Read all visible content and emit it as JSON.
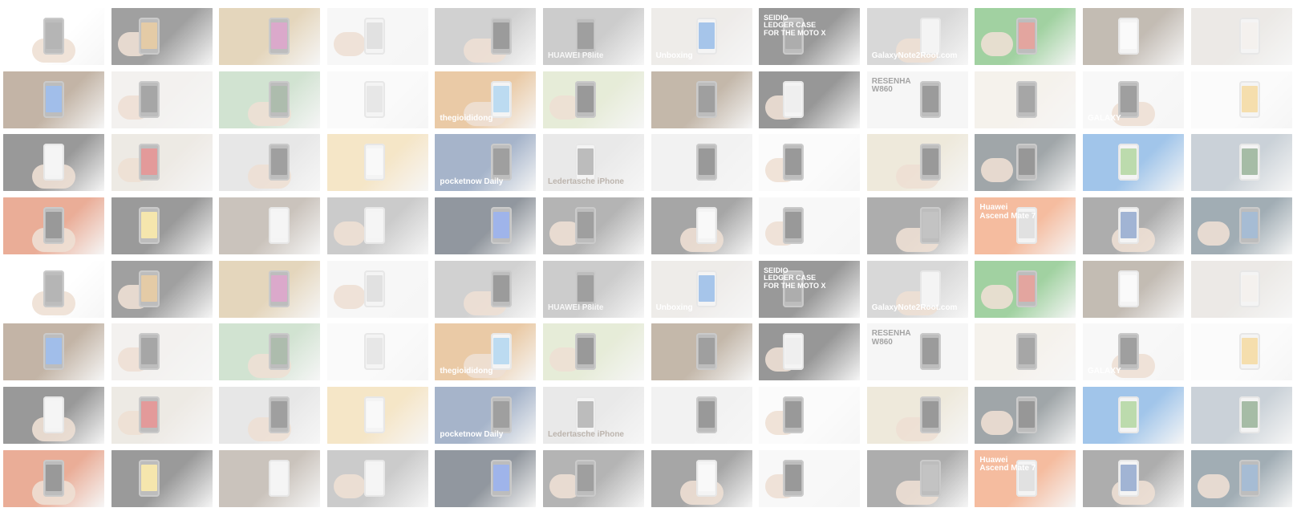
{
  "tiles": [
    {
      "bg": "#ffffff",
      "accent": "#5b5b5b",
      "phone": "dark",
      "hand": true,
      "caption": "",
      "captionColor": "#ffffff"
    },
    {
      "bg": "#2e2e2e",
      "accent": "#c48c3a",
      "phone": "dark",
      "hand": true,
      "caption": "",
      "captionColor": "#ffffff"
    },
    {
      "bg": "#c4a46c",
      "accent": "#b0408c",
      "phone": "dark",
      "hand": false,
      "caption": "",
      "captionColor": "#ffffff"
    },
    {
      "bg": "#eeeeee",
      "accent": "#bdbdbd",
      "phone": "light",
      "hand": true,
      "caption": "",
      "captionColor": "#ffffff"
    },
    {
      "bg": "#9a9a9a",
      "accent": "#222222",
      "phone": "dark",
      "hand": true,
      "caption": "",
      "captionColor": "#ffffff"
    },
    {
      "bg": "#8e8e8e",
      "accent": "#2b2b2b",
      "phone": "dark",
      "hand": false,
      "caption": "HUAWEI P8lite",
      "captionColor": "#eeeeee"
    },
    {
      "bg": "#d9d4cf",
      "accent": "#3a7fd0",
      "phone": "light",
      "hand": false,
      "caption": "Unboxing",
      "captionColor": "#ffffff"
    },
    {
      "bg": "#1d1d1d",
      "accent": "#4b4b4b",
      "phone": "dark",
      "hand": false,
      "caption": "SEIDIO\nLEDGER CASE\nFOR THE MOTO X",
      "captionColor": "#ffffff"
    },
    {
      "bg": "#a9a9a9",
      "accent": "#e6e6e6",
      "phone": "light",
      "hand": true,
      "caption": "GalaxyNote2Root.com",
      "captionColor": "#ffffff"
    },
    {
      "bg": "#2f9a2f",
      "accent": "#c0392b",
      "phone": "dark",
      "hand": true,
      "caption": "",
      "captionColor": "#ffffff"
    },
    {
      "bg": "#7a6a58",
      "accent": "#f4f4f4",
      "phone": "light",
      "hand": false,
      "caption": "",
      "captionColor": "#ffffff"
    },
    {
      "bg": "#d4cfc8",
      "accent": "#e6e1da",
      "phone": "light",
      "hand": false,
      "caption": "",
      "captionColor": "#ffffff"
    },
    {
      "bg": "#7a5a3a",
      "accent": "#2f6fd0",
      "phone": "dark",
      "hand": false,
      "caption": "",
      "captionColor": "#ffffff"
    },
    {
      "bg": "#e4e1dc",
      "accent": "#3a3a3a",
      "phone": "dark",
      "hand": true,
      "caption": "",
      "captionColor": "#ffffff"
    },
    {
      "bg": "#9ac09a",
      "accent": "#4a6a4a",
      "phone": "dark",
      "hand": true,
      "caption": "",
      "captionColor": "#ffffff"
    },
    {
      "bg": "#f4f4f4",
      "accent": "#c9c9c9",
      "phone": "light",
      "hand": false,
      "caption": "",
      "captionColor": "#ffffff"
    },
    {
      "bg": "#d08a3a",
      "accent": "#6ab0e0",
      "phone": "light",
      "hand": true,
      "caption": "thegioididong",
      "captionColor": "#ffffff"
    },
    {
      "bg": "#c8d4a8",
      "accent": "#1e1e1e",
      "phone": "dark",
      "hand": true,
      "caption": "",
      "captionColor": "#ffffff"
    },
    {
      "bg": "#7c6244",
      "accent": "#2c2c2c",
      "phone": "dark",
      "hand": false,
      "caption": "",
      "captionColor": "#ffffff"
    },
    {
      "bg": "#1a1a1a",
      "accent": "#dcdcdc",
      "phone": "light",
      "hand": true,
      "caption": "",
      "captionColor": "#ffffff"
    },
    {
      "bg": "#ececec",
      "accent": "#222222",
      "phone": "dark",
      "hand": false,
      "caption": "RESENHA\nW860",
      "captionColor": "#333333"
    },
    {
      "bg": "#e9e2d6",
      "accent": "#3a3a3a",
      "phone": "dark",
      "hand": false,
      "caption": "",
      "captionColor": "#ffffff"
    },
    {
      "bg": "#efefef",
      "accent": "#2a2a2a",
      "phone": "dark",
      "hand": true,
      "caption": "GALAXY",
      "captionColor": "#ffffff"
    },
    {
      "bg": "#f7f7f7",
      "accent": "#e8b54a",
      "phone": "light",
      "hand": false,
      "caption": "",
      "captionColor": "#ffffff"
    },
    {
      "bg": "#1e1e1e",
      "accent": "#e8e8e8",
      "phone": "light",
      "hand": true,
      "caption": "",
      "captionColor": "#ffffff"
    },
    {
      "bg": "#d8d0c4",
      "accent": "#c02020",
      "phone": "dark",
      "hand": true,
      "caption": "",
      "captionColor": "#ffffff"
    },
    {
      "bg": "#c9c9c9",
      "accent": "#2a2a2a",
      "phone": "dark",
      "hand": true,
      "caption": "",
      "captionColor": "#ffffff"
    },
    {
      "bg": "#e9c784",
      "accent": "#f2f2f2",
      "phone": "light",
      "hand": false,
      "caption": "",
      "captionColor": "#ffffff"
    },
    {
      "bg": "#3a5a8a",
      "accent": "#2a2a2a",
      "phone": "dark",
      "hand": false,
      "caption": "pocketnow Daily",
      "captionColor": "#ffffff"
    },
    {
      "bg": "#cfcfcf",
      "accent": "#6a6a6a",
      "phone": "light",
      "hand": false,
      "caption": "Ledertasche iPhone",
      "captionColor": "#6a5a4a"
    },
    {
      "bg": "#e2e2e2",
      "accent": "#1e1e1e",
      "phone": "dark",
      "hand": false,
      "caption": "",
      "captionColor": "#ffffff"
    },
    {
      "bg": "#f7f7f7",
      "accent": "#1e1e1e",
      "phone": "dark",
      "hand": true,
      "caption": "",
      "captionColor": "#ffffff"
    },
    {
      "bg": "#d9ceb0",
      "accent": "#1e1e1e",
      "phone": "dark",
      "hand": true,
      "caption": "",
      "captionColor": "#ffffff"
    },
    {
      "bg": "#2d3a40",
      "accent": "#1a1a1a",
      "phone": "dark",
      "hand": true,
      "caption": "",
      "captionColor": "#ffffff"
    },
    {
      "bg": "#2f7fd0",
      "accent": "#6ab04a",
      "phone": "light",
      "hand": false,
      "caption": "",
      "captionColor": "#ffffff"
    },
    {
      "bg": "#8a9aa8",
      "accent": "#3a6a3a",
      "phone": "light",
      "hand": false,
      "caption": "",
      "captionColor": "#ffffff"
    },
    {
      "bg": "#d04a1a",
      "accent": "#1e1e1e",
      "phone": "dark",
      "hand": true,
      "caption": "",
      "captionColor": "#ffffff"
    },
    {
      "bg": "#202020",
      "accent": "#e8c84a",
      "phone": "dark",
      "hand": false,
      "caption": "",
      "captionColor": "#ffffff"
    },
    {
      "bg": "#8a7a6a",
      "accent": "#e8e8e8",
      "phone": "light",
      "hand": false,
      "caption": "",
      "captionColor": "#ffffff"
    },
    {
      "bg": "#8c8c8c",
      "accent": "#e9e9e9",
      "phone": "light",
      "hand": true,
      "caption": "",
      "captionColor": "#ffffff"
    },
    {
      "bg": "#0d1a2a",
      "accent": "#2a5ad0",
      "phone": "dark",
      "hand": false,
      "caption": "",
      "captionColor": "#ffffff"
    },
    {
      "bg": "#5a5a5a",
      "accent": "#2a2a2a",
      "phone": "dark",
      "hand": true,
      "caption": "",
      "captionColor": "#ffffff"
    },
    {
      "bg": "#3a3a3a",
      "accent": "#f1f1f1",
      "phone": "light",
      "hand": true,
      "caption": "",
      "captionColor": "#ffffff"
    },
    {
      "bg": "#f0f0f0",
      "accent": "#1e1e1e",
      "phone": "dark",
      "hand": true,
      "caption": "",
      "captionColor": "#ffffff"
    },
    {
      "bg": "#4a4a4a",
      "accent": "#7a7a7a",
      "phone": "dark",
      "hand": true,
      "caption": "",
      "captionColor": "#ffffff"
    },
    {
      "bg": "#e86a2a",
      "accent": "#bcbcbc",
      "phone": "light",
      "hand": false,
      "caption": "Huawei\nAscend Mate 7",
      "captionColor": "#ffffff"
    },
    {
      "bg": "#4a4a4a",
      "accent": "#2f5aa0",
      "phone": "light",
      "hand": true,
      "caption": "",
      "captionColor": "#ffffff"
    },
    {
      "bg": "#2f4a5a",
      "accent": "#3a6aa0",
      "phone": "dark",
      "hand": true,
      "caption": "",
      "captionColor": "#ffffff"
    },
    {
      "bg": "#ffffff",
      "accent": "#5b5b5b",
      "phone": "dark",
      "hand": true,
      "caption": "",
      "captionColor": "#ffffff"
    },
    {
      "bg": "#2e2e2e",
      "accent": "#c48c3a",
      "phone": "dark",
      "hand": true,
      "caption": "",
      "captionColor": "#ffffff"
    },
    {
      "bg": "#c4a46c",
      "accent": "#b0408c",
      "phone": "dark",
      "hand": false,
      "caption": "",
      "captionColor": "#ffffff"
    },
    {
      "bg": "#eeeeee",
      "accent": "#bdbdbd",
      "phone": "light",
      "hand": true,
      "caption": "",
      "captionColor": "#ffffff"
    },
    {
      "bg": "#9a9a9a",
      "accent": "#222222",
      "phone": "dark",
      "hand": true,
      "caption": "",
      "captionColor": "#ffffff"
    },
    {
      "bg": "#8e8e8e",
      "accent": "#2b2b2b",
      "phone": "dark",
      "hand": false,
      "caption": "HUAWEI P8lite",
      "captionColor": "#eeeeee"
    },
    {
      "bg": "#d9d4cf",
      "accent": "#3a7fd0",
      "phone": "light",
      "hand": false,
      "caption": "Unboxing",
      "captionColor": "#ffffff"
    },
    {
      "bg": "#1d1d1d",
      "accent": "#4b4b4b",
      "phone": "dark",
      "hand": false,
      "caption": "SEIDIO\nLEDGER CASE\nFOR THE MOTO X",
      "captionColor": "#ffffff"
    },
    {
      "bg": "#a9a9a9",
      "accent": "#e6e6e6",
      "phone": "light",
      "hand": true,
      "caption": "GalaxyNote2Root.com",
      "captionColor": "#ffffff"
    },
    {
      "bg": "#2f9a2f",
      "accent": "#c0392b",
      "phone": "dark",
      "hand": true,
      "caption": "",
      "captionColor": "#ffffff"
    },
    {
      "bg": "#7a6a58",
      "accent": "#f4f4f4",
      "phone": "light",
      "hand": false,
      "caption": "",
      "captionColor": "#ffffff"
    },
    {
      "bg": "#d4cfc8",
      "accent": "#e6e1da",
      "phone": "light",
      "hand": false,
      "caption": "",
      "captionColor": "#ffffff"
    },
    {
      "bg": "#7a5a3a",
      "accent": "#2f6fd0",
      "phone": "dark",
      "hand": false,
      "caption": "",
      "captionColor": "#ffffff"
    },
    {
      "bg": "#e4e1dc",
      "accent": "#3a3a3a",
      "phone": "dark",
      "hand": true,
      "caption": "",
      "captionColor": "#ffffff"
    },
    {
      "bg": "#9ac09a",
      "accent": "#4a6a4a",
      "phone": "dark",
      "hand": true,
      "caption": "",
      "captionColor": "#ffffff"
    },
    {
      "bg": "#f4f4f4",
      "accent": "#c9c9c9",
      "phone": "light",
      "hand": false,
      "caption": "",
      "captionColor": "#ffffff"
    },
    {
      "bg": "#d08a3a",
      "accent": "#6ab0e0",
      "phone": "light",
      "hand": true,
      "caption": "thegioididong",
      "captionColor": "#ffffff"
    },
    {
      "bg": "#c8d4a8",
      "accent": "#1e1e1e",
      "phone": "dark",
      "hand": true,
      "caption": "",
      "captionColor": "#ffffff"
    },
    {
      "bg": "#7c6244",
      "accent": "#2c2c2c",
      "phone": "dark",
      "hand": false,
      "caption": "",
      "captionColor": "#ffffff"
    },
    {
      "bg": "#1a1a1a",
      "accent": "#dcdcdc",
      "phone": "light",
      "hand": true,
      "caption": "",
      "captionColor": "#ffffff"
    },
    {
      "bg": "#ececec",
      "accent": "#222222",
      "phone": "dark",
      "hand": false,
      "caption": "RESENHA\nW860",
      "captionColor": "#333333"
    },
    {
      "bg": "#e9e2d6",
      "accent": "#3a3a3a",
      "phone": "dark",
      "hand": false,
      "caption": "",
      "captionColor": "#ffffff"
    },
    {
      "bg": "#efefef",
      "accent": "#2a2a2a",
      "phone": "dark",
      "hand": true,
      "caption": "GALAXY",
      "captionColor": "#ffffff"
    },
    {
      "bg": "#f7f7f7",
      "accent": "#e8b54a",
      "phone": "light",
      "hand": false,
      "caption": "",
      "captionColor": "#ffffff"
    },
    {
      "bg": "#1e1e1e",
      "accent": "#e8e8e8",
      "phone": "light",
      "hand": true,
      "caption": "",
      "captionColor": "#ffffff"
    },
    {
      "bg": "#d8d0c4",
      "accent": "#c02020",
      "phone": "dark",
      "hand": true,
      "caption": "",
      "captionColor": "#ffffff"
    },
    {
      "bg": "#c9c9c9",
      "accent": "#2a2a2a",
      "phone": "dark",
      "hand": true,
      "caption": "",
      "captionColor": "#ffffff"
    },
    {
      "bg": "#e9c784",
      "accent": "#f2f2f2",
      "phone": "light",
      "hand": false,
      "caption": "",
      "captionColor": "#ffffff"
    },
    {
      "bg": "#3a5a8a",
      "accent": "#2a2a2a",
      "phone": "dark",
      "hand": false,
      "caption": "pocketnow Daily",
      "captionColor": "#ffffff"
    },
    {
      "bg": "#cfcfcf",
      "accent": "#6a6a6a",
      "phone": "light",
      "hand": false,
      "caption": "Ledertasche iPhone",
      "captionColor": "#6a5a4a"
    },
    {
      "bg": "#e2e2e2",
      "accent": "#1e1e1e",
      "phone": "dark",
      "hand": false,
      "caption": "",
      "captionColor": "#ffffff"
    },
    {
      "bg": "#f7f7f7",
      "accent": "#1e1e1e",
      "phone": "dark",
      "hand": true,
      "caption": "",
      "captionColor": "#ffffff"
    },
    {
      "bg": "#d9ceb0",
      "accent": "#1e1e1e",
      "phone": "dark",
      "hand": true,
      "caption": "",
      "captionColor": "#ffffff"
    },
    {
      "bg": "#2d3a40",
      "accent": "#1a1a1a",
      "phone": "dark",
      "hand": true,
      "caption": "",
      "captionColor": "#ffffff"
    },
    {
      "bg": "#2f7fd0",
      "accent": "#6ab04a",
      "phone": "light",
      "hand": false,
      "caption": "",
      "captionColor": "#ffffff"
    },
    {
      "bg": "#8a9aa8",
      "accent": "#3a6a3a",
      "phone": "light",
      "hand": false,
      "caption": "",
      "captionColor": "#ffffff"
    },
    {
      "bg": "#d04a1a",
      "accent": "#1e1e1e",
      "phone": "dark",
      "hand": true,
      "caption": "",
      "captionColor": "#ffffff"
    },
    {
      "bg": "#202020",
      "accent": "#e8c84a",
      "phone": "dark",
      "hand": false,
      "caption": "",
      "captionColor": "#ffffff"
    },
    {
      "bg": "#8a7a6a",
      "accent": "#e8e8e8",
      "phone": "light",
      "hand": false,
      "caption": "",
      "captionColor": "#ffffff"
    },
    {
      "bg": "#8c8c8c",
      "accent": "#e9e9e9",
      "phone": "light",
      "hand": true,
      "caption": "",
      "captionColor": "#ffffff"
    },
    {
      "bg": "#0d1a2a",
      "accent": "#2a5ad0",
      "phone": "dark",
      "hand": false,
      "caption": "",
      "captionColor": "#ffffff"
    },
    {
      "bg": "#5a5a5a",
      "accent": "#2a2a2a",
      "phone": "dark",
      "hand": true,
      "caption": "",
      "captionColor": "#ffffff"
    },
    {
      "bg": "#3a3a3a",
      "accent": "#f1f1f1",
      "phone": "light",
      "hand": true,
      "caption": "",
      "captionColor": "#ffffff"
    },
    {
      "bg": "#f0f0f0",
      "accent": "#1e1e1e",
      "phone": "dark",
      "hand": true,
      "caption": "",
      "captionColor": "#ffffff"
    },
    {
      "bg": "#4a4a4a",
      "accent": "#7a7a7a",
      "phone": "dark",
      "hand": true,
      "caption": "",
      "captionColor": "#ffffff"
    },
    {
      "bg": "#e86a2a",
      "accent": "#bcbcbc",
      "phone": "light",
      "hand": false,
      "caption": "Huawei\nAscend Mate 7",
      "captionColor": "#ffffff"
    },
    {
      "bg": "#4a4a4a",
      "accent": "#2f5aa0",
      "phone": "light",
      "hand": true,
      "caption": "",
      "captionColor": "#ffffff"
    },
    {
      "bg": "#2f4a5a",
      "accent": "#3a6aa0",
      "phone": "dark",
      "hand": true,
      "caption": "",
      "captionColor": "#ffffff"
    }
  ]
}
